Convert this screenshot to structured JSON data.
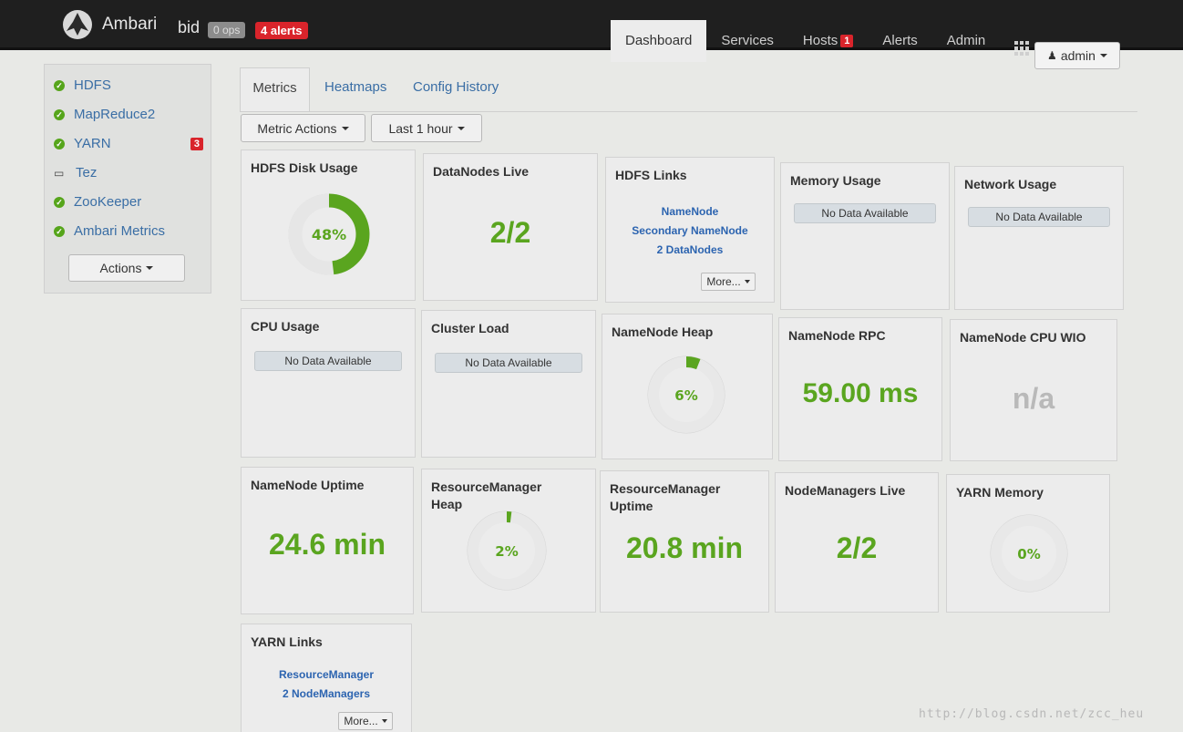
{
  "header": {
    "brand": "Ambari",
    "cluster": "bid",
    "ops_badge": "0 ops",
    "alerts_badge": "4 alerts",
    "nav": [
      {
        "label": "Dashboard"
      },
      {
        "label": "Services"
      },
      {
        "label": "Hosts",
        "badge": "1"
      },
      {
        "label": "Alerts"
      },
      {
        "label": "Admin"
      }
    ],
    "user_menu": "admin"
  },
  "sidebar": {
    "services": [
      {
        "label": "HDFS",
        "status": "ok"
      },
      {
        "label": "MapReduce2",
        "status": "ok"
      },
      {
        "label": "YARN",
        "status": "ok",
        "badge": "3"
      },
      {
        "label": "Tez",
        "status": "client"
      },
      {
        "label": "ZooKeeper",
        "status": "ok"
      },
      {
        "label": "Ambari Metrics",
        "status": "ok"
      }
    ],
    "actions_label": "Actions"
  },
  "tabs": [
    "Metrics",
    "Heatmaps",
    "Config History"
  ],
  "toolbar": {
    "metric_actions": "Metric Actions",
    "time_range": "Last 1 hour"
  },
  "widgets": {
    "hdfs_disk_usage": {
      "title": "HDFS Disk Usage",
      "value": "48%",
      "percent": 48
    },
    "datanodes_live": {
      "title": "DataNodes Live",
      "value": "2/2"
    },
    "hdfs_links": {
      "title": "HDFS Links",
      "links": [
        "NameNode",
        "Secondary NameNode",
        "2 DataNodes"
      ],
      "more": "More..."
    },
    "memory_usage": {
      "title": "Memory Usage",
      "nodata": "No Data Available"
    },
    "network_usage": {
      "title": "Network Usage",
      "nodata": "No Data Available"
    },
    "cpu_usage": {
      "title": "CPU Usage",
      "nodata": "No Data Available"
    },
    "cluster_load": {
      "title": "Cluster Load",
      "nodata": "No Data Available"
    },
    "namenode_heap": {
      "title": "NameNode Heap",
      "value": "6%",
      "percent": 6
    },
    "namenode_rpc": {
      "title": "NameNode RPC",
      "value": "59.00 ms"
    },
    "namenode_cpu_wio": {
      "title": "NameNode CPU WIO",
      "value": "n/a"
    },
    "namenode_uptime": {
      "title": "NameNode Uptime",
      "value": "24.6 min"
    },
    "rm_heap": {
      "title": "ResourceManager Heap",
      "value": "2%",
      "percent": 2
    },
    "rm_uptime": {
      "title": "ResourceManager Uptime",
      "value": "20.8 min"
    },
    "nodemanagers_live": {
      "title": "NodeManagers Live",
      "value": "2/2"
    },
    "yarn_memory": {
      "title": "YARN Memory",
      "value": "0%",
      "percent": 0
    },
    "yarn_links": {
      "title": "YARN Links",
      "links": [
        "ResourceManager",
        "2 NodeManagers"
      ],
      "more": "More..."
    }
  },
  "watermark": "http://blog.csdn.net/zcc_heu",
  "colors": {
    "accent_green": "#5aa51f",
    "alert_red": "#d9242b",
    "link_blue": "#2c64b0"
  }
}
